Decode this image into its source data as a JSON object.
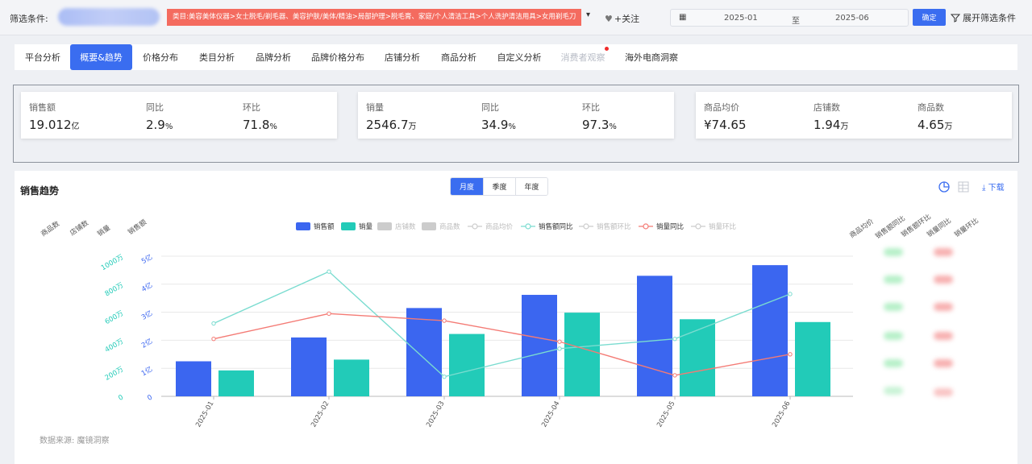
{
  "filter": {
    "label": "筛选条件:",
    "category_tag": "类目:美容美体仪器>女士脱毛/剃毛器、美容护肤/美体/精油>局部护理>脱毛膏、家庭/个人清洁工具>个人洗护清洁用具>女用剃毛刀",
    "follow_label": "+关注",
    "date_start": "2025-01",
    "date_sep": "至",
    "date_end": "2025-06",
    "confirm_label": "确定",
    "expand_label": "展开筛选条件"
  },
  "tabs": [
    {
      "label": "平台分析"
    },
    {
      "label": "概要&趋势"
    },
    {
      "label": "价格分布"
    },
    {
      "label": "类目分析"
    },
    {
      "label": "品牌分析"
    },
    {
      "label": "品牌价格分布"
    },
    {
      "label": "店铺分析"
    },
    {
      "label": "商品分析"
    },
    {
      "label": "自定义分析"
    },
    {
      "label": "消费者观察"
    },
    {
      "label": "海外电商洞察"
    }
  ],
  "kpis": [
    {
      "label": "销售额",
      "value": "19.012",
      "unit": "亿"
    },
    {
      "label": "同比",
      "value": "2.9",
      "unit": "%"
    },
    {
      "label": "环比",
      "value": "71.8",
      "unit": "%"
    },
    {
      "label": "销量",
      "value": "2546.7",
      "unit": "万"
    },
    {
      "label": "同比",
      "value": "34.9",
      "unit": "%"
    },
    {
      "label": "环比",
      "value": "97.3",
      "unit": "%"
    },
    {
      "label": "商品均价",
      "value": "¥74.65",
      "unit": ""
    },
    {
      "label": "店铺数",
      "value": "1.94",
      "unit": "万"
    },
    {
      "label": "商品数",
      "value": "4.65",
      "unit": "万"
    }
  ],
  "chart_panel": {
    "title": "销售趋势",
    "periods": [
      "月度",
      "季度",
      "年度"
    ],
    "download_label": "下载",
    "source": "数据来源: 魔镜洞察",
    "left_axis_labels": [
      "商品数",
      "店铺数",
      "销量",
      "销售额"
    ],
    "right_axis_labels": [
      "商品均价",
      "销售额同比",
      "销售额环比",
      "销量同比",
      "销量环比"
    ]
  },
  "colors": {
    "accent": "#3a6df0",
    "sales": "#3b66f0",
    "volume": "#22cbb8",
    "sales_yoy": "#7adcd0",
    "volume_yoy": "#f47b75",
    "tag_red": "#f46b5f"
  },
  "chart_data": {
    "type": "bar",
    "categories": [
      "2025-01",
      "2025-02",
      "2025-03",
      "2025-04",
      "2025-05",
      "2025-06"
    ],
    "legend": [
      "销售额",
      "销量",
      "店铺数",
      "商品数",
      "商品均价",
      "销售额同比",
      "销售额环比",
      "销量同比",
      "销量环比"
    ],
    "legend_active": [
      true,
      true,
      false,
      false,
      false,
      true,
      false,
      true,
      false
    ],
    "series": [
      {
        "name": "销售额",
        "type": "bar",
        "axis": "销售额",
        "values": [
          1.25,
          2.1,
          3.15,
          3.62,
          4.3,
          4.68
        ]
      },
      {
        "name": "销量",
        "type": "bar",
        "axis": "销量",
        "values": [
          185,
          262,
          445,
          597,
          550,
          530
        ]
      },
      {
        "name": "销售额同比",
        "type": "line",
        "values": [
          0.52,
          0.89,
          0.14,
          0.34,
          0.41,
          0.73
        ]
      },
      {
        "name": "销量同比",
        "type": "line",
        "values": [
          0.41,
          0.59,
          0.54,
          0.39,
          0.15,
          0.3
        ]
      }
    ],
    "axis_sales": {
      "ticks": [
        "0",
        "1亿",
        "2亿",
        "3亿",
        "4亿",
        "5亿"
      ],
      "ylim": [
        0,
        5
      ]
    },
    "axis_volume": {
      "ticks": [
        "0",
        "200万",
        "400万",
        "600万",
        "800万",
        "1000万"
      ],
      "ylim": [
        0,
        1000
      ]
    },
    "grid": true,
    "legend_position": "top-center"
  }
}
